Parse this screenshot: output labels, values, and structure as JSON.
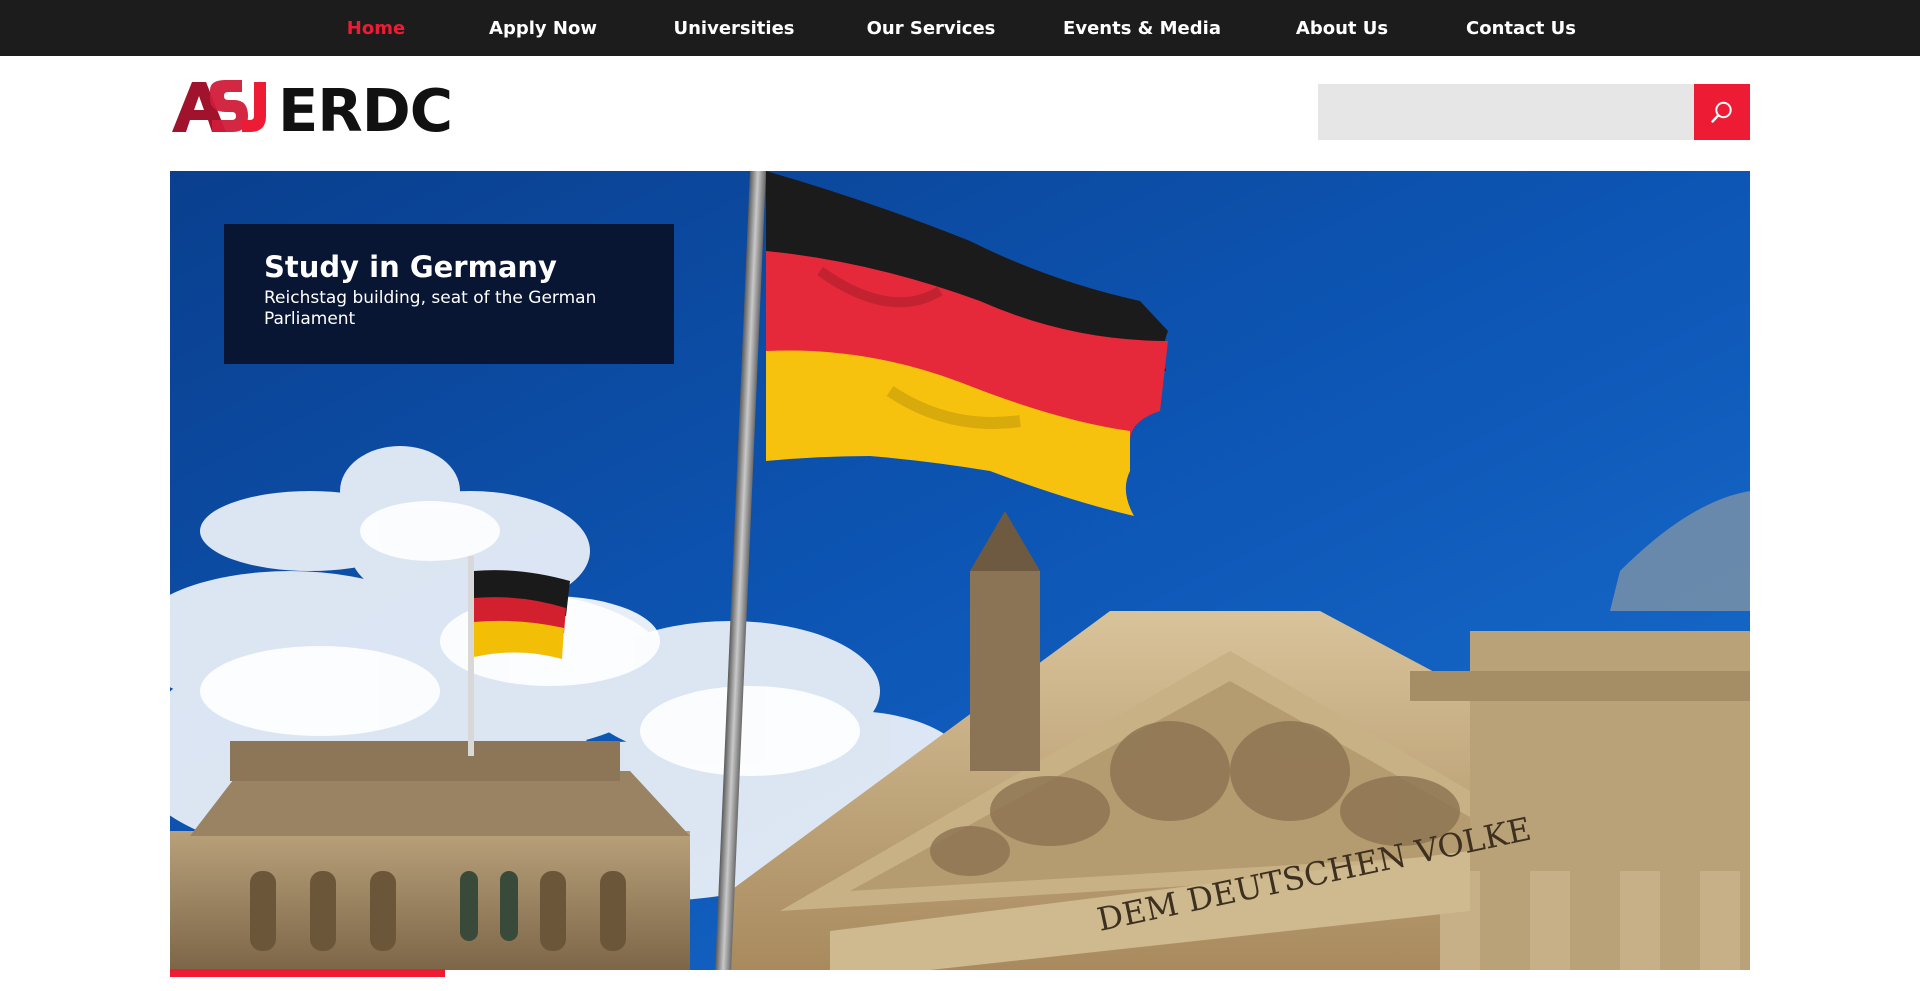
{
  "nav": {
    "items": [
      {
        "label": "Home",
        "active": true
      },
      {
        "label": "Apply Now",
        "active": false
      },
      {
        "label": "Universities",
        "active": false
      },
      {
        "label": "Our Services",
        "active": false
      },
      {
        "label": "Events & Media",
        "active": false
      },
      {
        "label": "About Us",
        "active": false
      },
      {
        "label": "Contact Us",
        "active": false
      }
    ]
  },
  "header": {
    "logo_mark": "ASJ",
    "logo_text": "ERDC",
    "search": {
      "placeholder": "",
      "value": "",
      "icon": "search-icon"
    }
  },
  "hero": {
    "title": "Study in Germany",
    "subtitle": "Reichstag building, seat of the German Parliament",
    "inscription": "DEM DEUTSCHEN VOLKE"
  },
  "colors": {
    "accent": "#ed1b34",
    "nav_bg": "#1c1c1c",
    "caption_bg": "#081533",
    "search_bg": "#e6e6e6"
  }
}
